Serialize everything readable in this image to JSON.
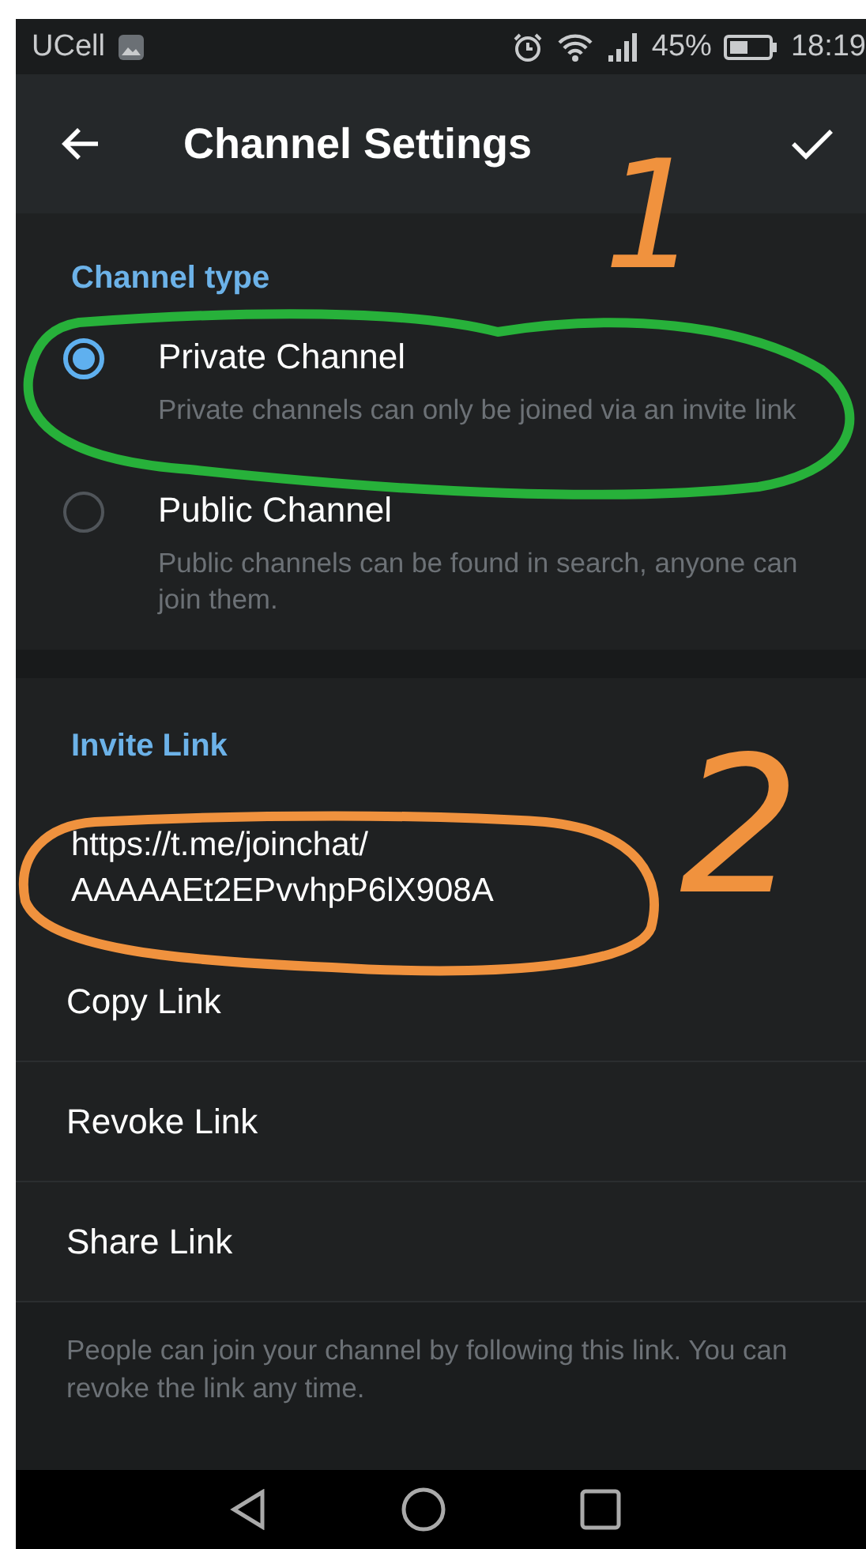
{
  "status_bar": {
    "carrier": "UCell",
    "battery": "45%",
    "time": "18:19"
  },
  "header": {
    "title": "Channel Settings"
  },
  "channel_type": {
    "heading": "Channel type",
    "options": [
      {
        "label": "Private Channel",
        "description": "Private channels can only be joined via an invite link",
        "selected": true
      },
      {
        "label": "Public Channel",
        "description": "Public channels can be found in search, anyone can join them.",
        "selected": false
      }
    ]
  },
  "invite_link": {
    "heading": "Invite Link",
    "url": "https://t.me/joinchat/ AAAAAEt2EPvvhpP6lX908A",
    "actions": [
      "Copy Link",
      "Revoke Link",
      "Share Link"
    ],
    "footer": "People can join your channel by following this link. You can revoke the link any time."
  },
  "annotations": [
    {
      "label": "1",
      "color": "#f0923e"
    },
    {
      "label": "2",
      "color": "#f0923e"
    }
  ]
}
